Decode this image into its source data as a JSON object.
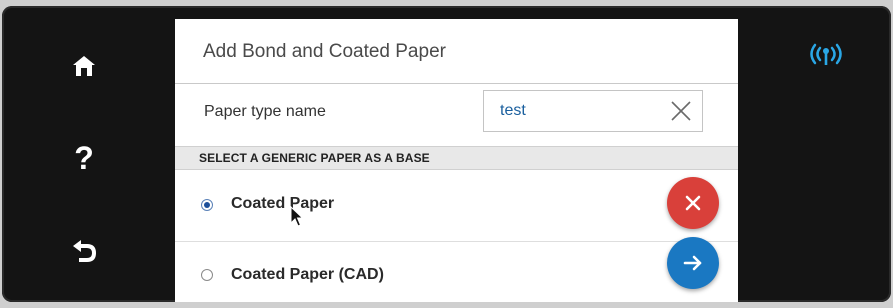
{
  "dialog": {
    "title": "Add Bond and Coated Paper",
    "field_label": "Paper type name",
    "field_value": "test",
    "section_header": "SELECT A GENERIC PAPER AS A BASE",
    "options": [
      {
        "label": "Coated Paper",
        "checked": true
      },
      {
        "label": "Coated Paper (CAD)",
        "checked": false
      }
    ]
  },
  "icons": {
    "home": "home-icon",
    "help": "help-icon",
    "back": "back-icon",
    "wireless": "wireless-icon",
    "clear": "close-icon",
    "cancel": "cancel-icon",
    "next": "arrow-right-icon"
  },
  "colors": {
    "accent_blue": "#1a78c2",
    "cancel_red": "#d9403a",
    "wireless_cyan": "#2aa7e6",
    "bezel": "#141414"
  }
}
